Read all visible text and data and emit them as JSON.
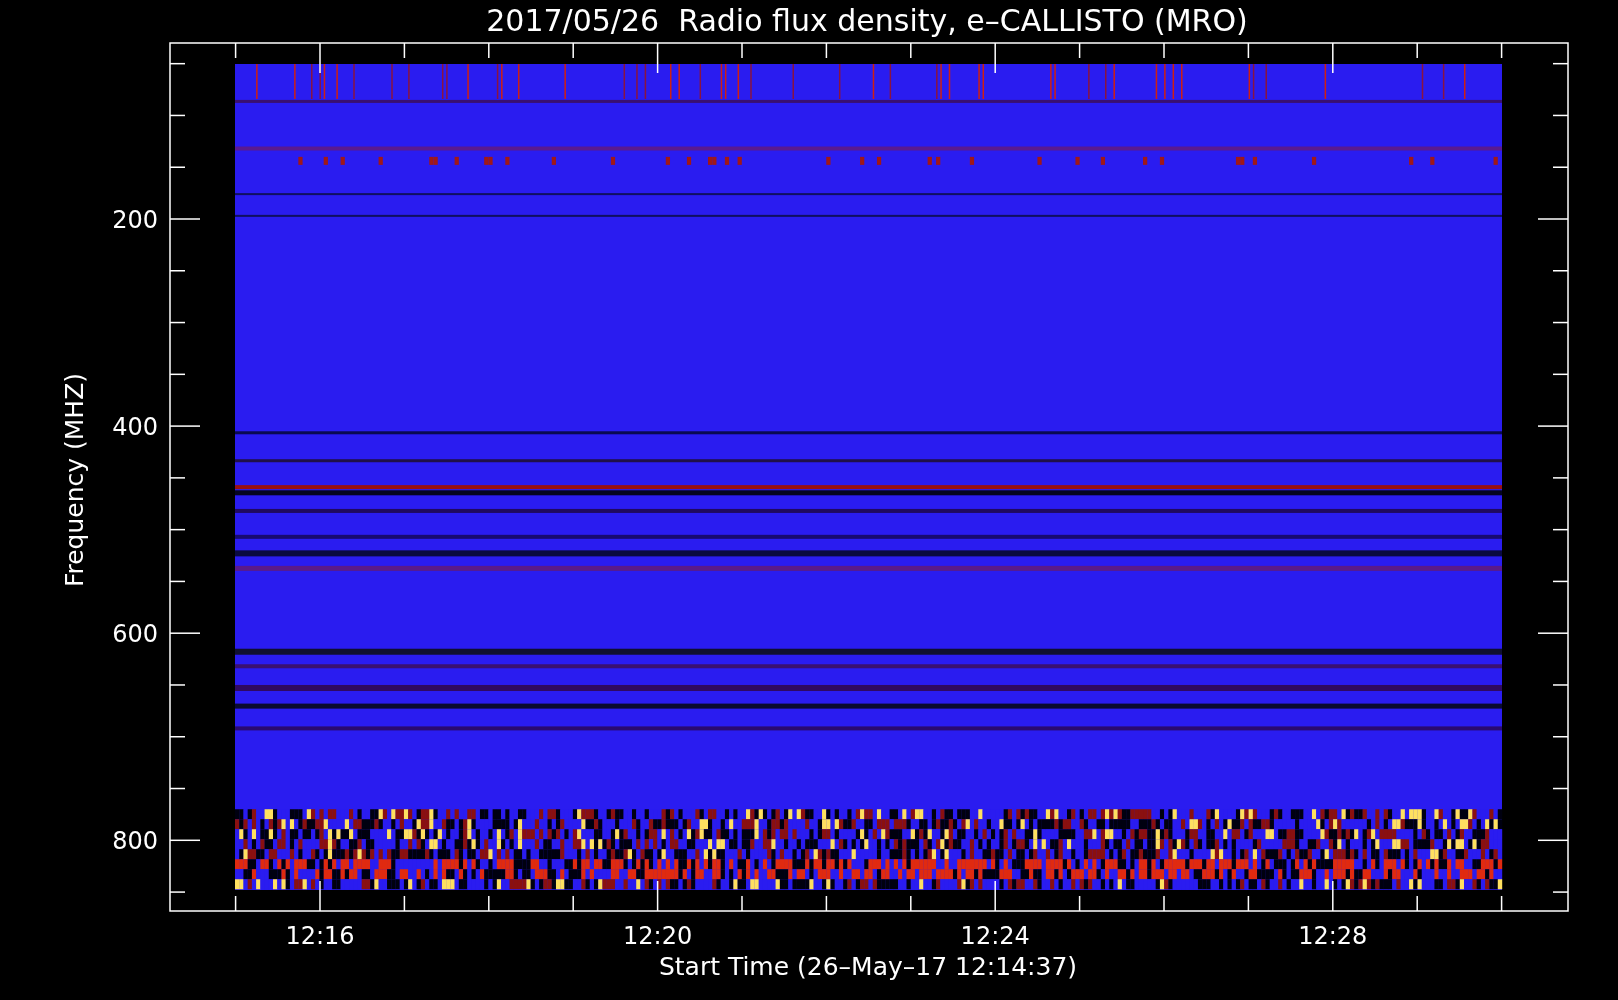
{
  "title": "2017/05/26  Radio flux density, e–CALLISTO (MRO)",
  "y_axis": {
    "label": "Frequency (MHZ)",
    "ticks": [
      "200",
      "400",
      "600",
      "800"
    ]
  },
  "x_axis": {
    "label": "Start Time (26–May–17 12:14:37)",
    "ticks": [
      "12:16",
      "12:20",
      "12:24",
      "12:28"
    ]
  }
}
